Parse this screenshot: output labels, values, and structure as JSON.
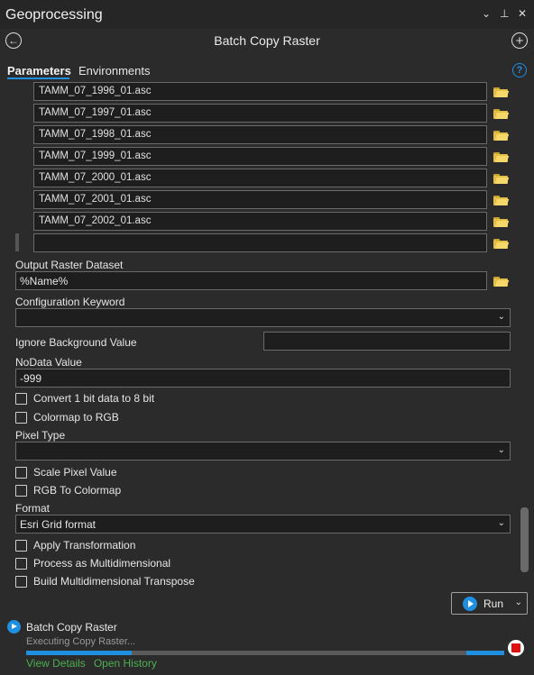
{
  "window": {
    "title": "Geoprocessing",
    "controls": [
      "⌄",
      "⊥",
      "✕"
    ]
  },
  "nav": {
    "back_icon": "←",
    "tool_title": "Batch Copy Raster",
    "add_icon": "+"
  },
  "tabs": {
    "parameters": "Parameters",
    "environments": "Environments",
    "help": "?"
  },
  "input_rasters": [
    "TAMM_07_1996_01.asc",
    "TAMM_07_1997_01.asc",
    "TAMM_07_1998_01.asc",
    "TAMM_07_1999_01.asc",
    "TAMM_07_2000_01.asc",
    "TAMM_07_2001_01.asc",
    "TAMM_07_2002_01.asc",
    ""
  ],
  "params": {
    "output_label": "Output Raster Dataset",
    "output_value": "%Name%",
    "config_label": "Configuration Keyword",
    "config_value": "",
    "ignore_bg_label": "Ignore Background Value",
    "ignore_bg_value": "",
    "nodata_label": "NoData Value",
    "nodata_value": "-999",
    "convert_1bit": "Convert 1 bit data to 8 bit",
    "colormap_rgb": "Colormap to RGB",
    "pixel_type_label": "Pixel Type",
    "pixel_type_value": "",
    "scale_pixel": "Scale Pixel Value",
    "rgb_colormap": "RGB To Colormap",
    "format_label": "Format",
    "format_value": "Esri Grid format",
    "apply_transform": "Apply Transformation",
    "process_multidim": "Process as Multidimensional",
    "build_transpose": "Build Multidimensional Transpose",
    "chevron": "⌄"
  },
  "run": {
    "label": "Run",
    "chevron": "⌄"
  },
  "status": {
    "tool": "Batch Copy Raster",
    "message": "Executing Copy Raster...",
    "progress_start_fraction": 0.22,
    "progress_end_fraction": 0.08,
    "view_details": "View Details",
    "open_history": "Open History"
  },
  "colors": {
    "accent": "#1f8fe0",
    "link": "#4caf50",
    "stop": "#e01010",
    "folder": "#e5bf45"
  },
  "icons": {
    "folder": "folder-icon",
    "run": "play-icon",
    "stop": "stop-icon",
    "help": "help-icon"
  }
}
